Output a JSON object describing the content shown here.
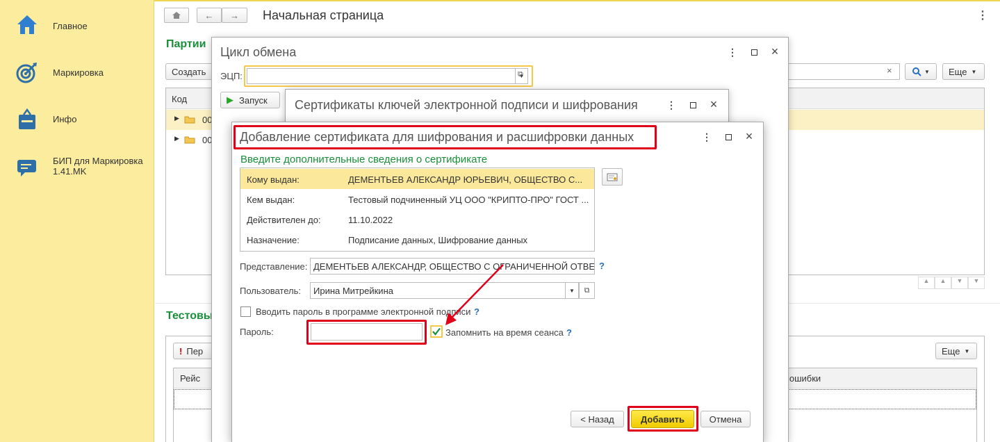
{
  "sidebar": {
    "items": [
      {
        "label": "Главное",
        "icon": "home-icon"
      },
      {
        "label": "Маркировка",
        "icon": "target-icon"
      },
      {
        "label": "Инфо",
        "icon": "bag-icon"
      },
      {
        "label": "БИП для Маркировка 1.41.MK",
        "icon": "chat-icon"
      }
    ]
  },
  "main": {
    "page_title": "Начальная страница",
    "section1_title": "Партии",
    "create_button": "Создать",
    "more_button": "Еще",
    "grid1_col_code": "Код",
    "grid1_rows": [
      "00",
      "00"
    ],
    "section2_title": "Тестовы",
    "perf_button": "Пер",
    "grid2_col_reys": "Рейс",
    "grid2_col_err": "е ошибки",
    "more_button2": "Еще"
  },
  "exchange_window": {
    "title": "Цикл обмена",
    "ecp_label": "ЭЦП:",
    "ecp_value": "",
    "run_button": "Запуск"
  },
  "certs_window": {
    "title": "Сертификаты ключей электронной подписи и шифрования"
  },
  "add_dialog": {
    "title": "Добавление сертификата для шифрования и расшифровки данных",
    "subtitle": "Введите дополнительные сведения о сертификате",
    "cert_table": [
      {
        "key": "Кому выдан:",
        "value": "ДЕМЕНТЬЕВ АЛЕКСАНДР ЮРЬЕВИЧ, ОБЩЕСТВО С..."
      },
      {
        "key": "Кем выдан:",
        "value": "Тестовый подчиненный УЦ ООО \"КРИПТО-ПРО\" ГОСТ ..."
      },
      {
        "key": "Действителен до:",
        "value": "11.10.2022"
      },
      {
        "key": "Назначение:",
        "value": "Подписание данных, Шифрование данных"
      }
    ],
    "representation_label": "Представление:",
    "representation_value": "ДЕМЕНТЬЕВ АЛЕКСАНДР, ОБЩЕСТВО С ОГРАНИЧЕННОЙ ОТВЕ",
    "user_label": "Пользователь:",
    "user_value": "Ирина Митрейкина",
    "enter_password_checkbox": "Вводить пароль в программе электронной подписи",
    "enter_password_checked": false,
    "password_label": "Пароль:",
    "password_value": "",
    "remember_checkbox": "Запомнить на время сеанса",
    "remember_checked": true,
    "help_mark": "?",
    "back_button": "< Назад",
    "add_button": "Добавить",
    "cancel_button": "Отмена"
  },
  "colors": {
    "sidebar_bg": "#fbec9e",
    "accent_green": "#1a8f3a",
    "highlight_red": "#e0001a",
    "primary_button": "#f5d600"
  }
}
